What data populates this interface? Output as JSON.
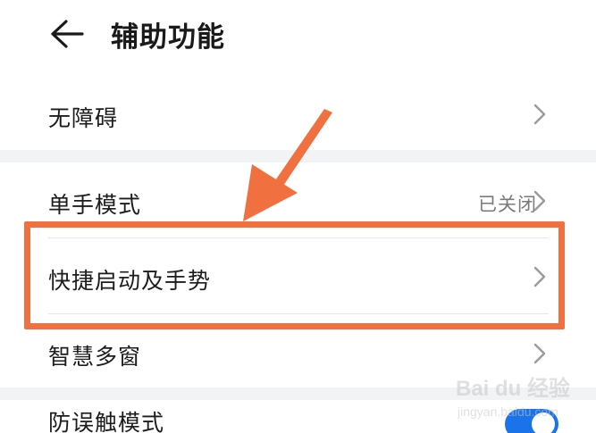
{
  "header": {
    "back_icon": "arrow-left-icon",
    "title": "辅助功能"
  },
  "items": [
    {
      "label": "无障碍",
      "value": "",
      "icon": "chevron-right-icon"
    },
    {
      "label": "单手模式",
      "value": "已关闭",
      "icon": "chevron-right-icon"
    },
    {
      "label": "快捷启动及手势",
      "value": "",
      "icon": "chevron-right-icon"
    },
    {
      "label": "智慧多窗",
      "value": "",
      "icon": "chevron-right-icon"
    },
    {
      "label": "防误触模式",
      "toggle": true
    }
  ],
  "annotation": {
    "highlight_color": "#f07040",
    "arrow_color": "#f07040"
  },
  "watermark": {
    "logo": "Bai du 经验",
    "url": "jingyan.baidu.com"
  },
  "colors": {
    "toggle_on": "#1a73e8",
    "section_gap": "#f1f3f5"
  }
}
